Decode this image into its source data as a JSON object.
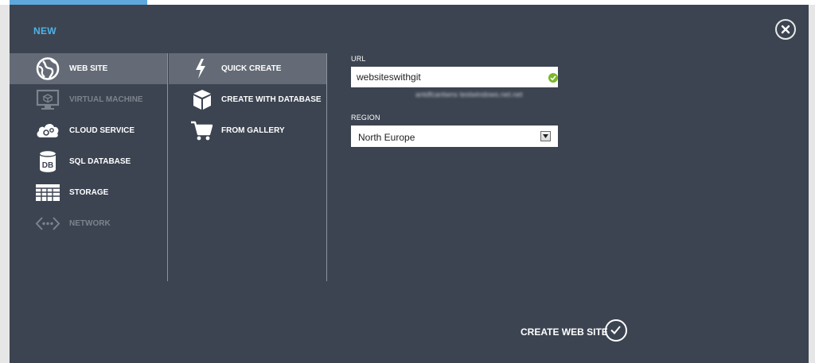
{
  "dialog": {
    "title": "NEW",
    "close_icon": "close-icon"
  },
  "categories": [
    {
      "label": "WEB SITE",
      "icon": "globe-icon",
      "selected": true,
      "enabled": true
    },
    {
      "label": "VIRTUAL MACHINE",
      "icon": "monitor-icon",
      "selected": false,
      "enabled": false
    },
    {
      "label": "CLOUD SERVICE",
      "icon": "cloud-gears-icon",
      "selected": false,
      "enabled": true
    },
    {
      "label": "SQL DATABASE",
      "icon": "database-icon",
      "selected": false,
      "enabled": true
    },
    {
      "label": "STORAGE",
      "icon": "storage-grid-icon",
      "selected": false,
      "enabled": true
    },
    {
      "label": "NETWORK",
      "icon": "network-icon",
      "selected": false,
      "enabled": false
    }
  ],
  "options": [
    {
      "label": "QUICK CREATE",
      "icon": "lightning-icon",
      "selected": true
    },
    {
      "label": "CREATE WITH DATABASE",
      "icon": "package-icon",
      "selected": false
    },
    {
      "label": "FROM GALLERY",
      "icon": "cart-icon",
      "selected": false
    }
  ],
  "form": {
    "url_label": "URL",
    "url_value": "websiteswithgit",
    "url_valid": true,
    "url_domain_hint": "antdfcantwns testwindows.net.net",
    "region_label": "REGION",
    "region_value": "North Europe"
  },
  "footer": {
    "create_label": "CREATE WEB SITE",
    "create_icon": "checkmark-circle-icon"
  },
  "colors": {
    "panel_bg": "#3c4451",
    "selected_bg": "#646b76",
    "accent": "#4fb3e8",
    "valid_green": "#7ab829"
  }
}
